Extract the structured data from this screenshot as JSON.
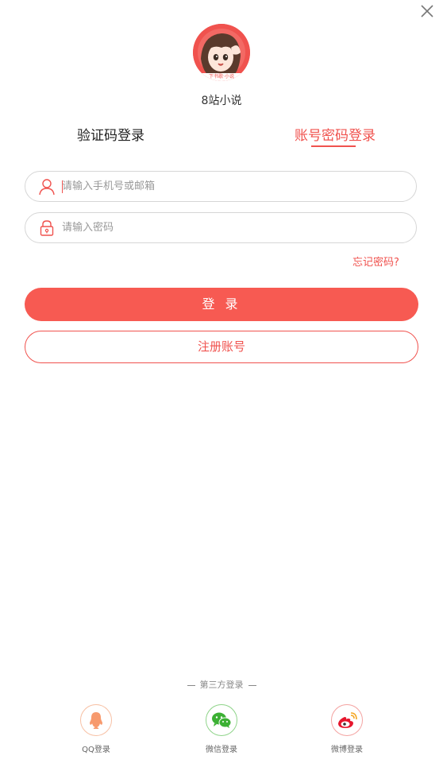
{
  "app": {
    "name": "8站小说",
    "avatar_caption": "下书歌·小说"
  },
  "tabs": [
    {
      "label": "验证码登录",
      "active": false
    },
    {
      "label": "账号密码登录",
      "active": true
    }
  ],
  "form": {
    "username_placeholder": "请输入手机号或邮箱",
    "username_value": "",
    "password_placeholder": "请输入密码",
    "password_value": "",
    "forgot_label": "忘记密码?"
  },
  "buttons": {
    "login_label": "登 录",
    "register_label": "注册账号"
  },
  "third_party": {
    "title": "第三方登录",
    "items": [
      {
        "label": "QQ登录",
        "icon": "qq-icon"
      },
      {
        "label": "微信登录",
        "icon": "wechat-icon"
      },
      {
        "label": "微博登录",
        "icon": "weibo-icon"
      }
    ]
  },
  "colors": {
    "accent": "#f0524e",
    "button": "#f75a52",
    "qq": "#f79a6e",
    "wechat": "#3cb034",
    "weibo": "#e6162d"
  }
}
